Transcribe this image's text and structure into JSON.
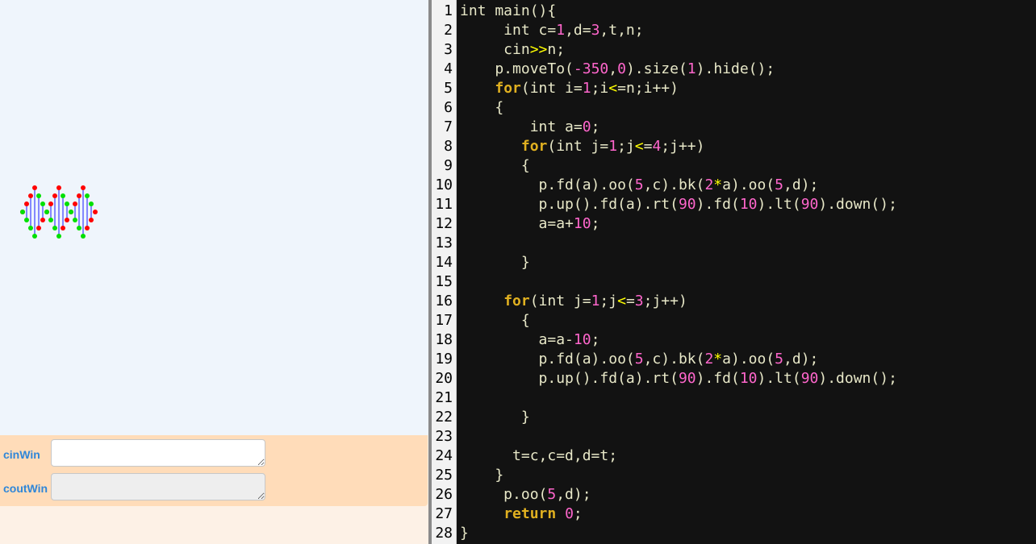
{
  "canvas": {
    "drawing": "dna-helix",
    "colors": {
      "strand_a": "#ff0000",
      "strand_b": "#00e000",
      "rung": "#1a1aff"
    }
  },
  "io": {
    "cin_label": "cinWin",
    "cout_label": "coutWin",
    "cin_value": "",
    "cout_value": ""
  },
  "editor": {
    "theme": {
      "background": "#121212",
      "keyword": "#e0b020",
      "number": "#ff66cc",
      "operator": "#ffff00",
      "text": "#e8e8c8",
      "gutter_bg": "#f2f2f2"
    },
    "lines": [
      {
        "n": "1",
        "segs": [
          {
            "t": "int main(){",
            "c": "text"
          }
        ]
      },
      {
        "n": "2",
        "segs": [
          {
            "t": "     int c=",
            "c": "text"
          },
          {
            "t": "1",
            "c": "number"
          },
          {
            "t": ",d=",
            "c": "text"
          },
          {
            "t": "3",
            "c": "number"
          },
          {
            "t": ",t,n;",
            "c": "text"
          }
        ]
      },
      {
        "n": "3",
        "segs": [
          {
            "t": "     cin",
            "c": "text"
          },
          {
            "t": ">>",
            "c": "operator"
          },
          {
            "t": "n;",
            "c": "text"
          }
        ]
      },
      {
        "n": "4",
        "segs": [
          {
            "t": "    p.moveTo(",
            "c": "text"
          },
          {
            "t": "-350",
            "c": "number"
          },
          {
            "t": ",",
            "c": "text"
          },
          {
            "t": "0",
            "c": "number"
          },
          {
            "t": ").size(",
            "c": "text"
          },
          {
            "t": "1",
            "c": "number"
          },
          {
            "t": ").hide();",
            "c": "text"
          }
        ]
      },
      {
        "n": "5",
        "segs": [
          {
            "t": "    ",
            "c": "text"
          },
          {
            "t": "for",
            "c": "keyword"
          },
          {
            "t": "(int i=",
            "c": "text"
          },
          {
            "t": "1",
            "c": "number"
          },
          {
            "t": ";i",
            "c": "text"
          },
          {
            "t": "<",
            "c": "operator"
          },
          {
            "t": "=n;i++)",
            "c": "text"
          }
        ]
      },
      {
        "n": "6",
        "segs": [
          {
            "t": "    {",
            "c": "text"
          }
        ]
      },
      {
        "n": "7",
        "segs": [
          {
            "t": "        int a=",
            "c": "text"
          },
          {
            "t": "0",
            "c": "number"
          },
          {
            "t": ";",
            "c": "text"
          }
        ]
      },
      {
        "n": "8",
        "segs": [
          {
            "t": "       ",
            "c": "text"
          },
          {
            "t": "for",
            "c": "keyword"
          },
          {
            "t": "(int j=",
            "c": "text"
          },
          {
            "t": "1",
            "c": "number"
          },
          {
            "t": ";j",
            "c": "text"
          },
          {
            "t": "<",
            "c": "operator"
          },
          {
            "t": "=",
            "c": "text"
          },
          {
            "t": "4",
            "c": "number"
          },
          {
            "t": ";j++)",
            "c": "text"
          }
        ]
      },
      {
        "n": "9",
        "segs": [
          {
            "t": "       {",
            "c": "text"
          }
        ]
      },
      {
        "n": "10",
        "segs": [
          {
            "t": "         p.fd(a).oo(",
            "c": "text"
          },
          {
            "t": "5",
            "c": "number"
          },
          {
            "t": ",c).bk(",
            "c": "text"
          },
          {
            "t": "2",
            "c": "number"
          },
          {
            "t": "*",
            "c": "operator"
          },
          {
            "t": "a).oo(",
            "c": "text"
          },
          {
            "t": "5",
            "c": "number"
          },
          {
            "t": ",d);",
            "c": "text"
          }
        ]
      },
      {
        "n": "11",
        "segs": [
          {
            "t": "         p.up().fd(a).rt(",
            "c": "text"
          },
          {
            "t": "90",
            "c": "number"
          },
          {
            "t": ").fd(",
            "c": "text"
          },
          {
            "t": "10",
            "c": "number"
          },
          {
            "t": ").lt(",
            "c": "text"
          },
          {
            "t": "90",
            "c": "number"
          },
          {
            "t": ").down();",
            "c": "text"
          }
        ]
      },
      {
        "n": "12",
        "segs": [
          {
            "t": "         a=a+",
            "c": "text"
          },
          {
            "t": "10",
            "c": "number"
          },
          {
            "t": ";",
            "c": "text"
          }
        ]
      },
      {
        "n": "13",
        "segs": [
          {
            "t": "",
            "c": "text"
          }
        ]
      },
      {
        "n": "14",
        "segs": [
          {
            "t": "       }",
            "c": "text"
          }
        ]
      },
      {
        "n": "15",
        "segs": [
          {
            "t": "",
            "c": "text"
          }
        ]
      },
      {
        "n": "16",
        "segs": [
          {
            "t": "     ",
            "c": "text"
          },
          {
            "t": "for",
            "c": "keyword"
          },
          {
            "t": "(int j=",
            "c": "text"
          },
          {
            "t": "1",
            "c": "number"
          },
          {
            "t": ";j",
            "c": "text"
          },
          {
            "t": "<",
            "c": "operator"
          },
          {
            "t": "=",
            "c": "text"
          },
          {
            "t": "3",
            "c": "number"
          },
          {
            "t": ";j++)",
            "c": "text"
          }
        ]
      },
      {
        "n": "17",
        "segs": [
          {
            "t": "       {",
            "c": "text"
          }
        ]
      },
      {
        "n": "18",
        "segs": [
          {
            "t": "         a=a-",
            "c": "text"
          },
          {
            "t": "10",
            "c": "number"
          },
          {
            "t": ";",
            "c": "text"
          }
        ]
      },
      {
        "n": "19",
        "segs": [
          {
            "t": "         p.fd(a).oo(",
            "c": "text"
          },
          {
            "t": "5",
            "c": "number"
          },
          {
            "t": ",c).bk(",
            "c": "text"
          },
          {
            "t": "2",
            "c": "number"
          },
          {
            "t": "*",
            "c": "operator"
          },
          {
            "t": "a).oo(",
            "c": "text"
          },
          {
            "t": "5",
            "c": "number"
          },
          {
            "t": ",d);",
            "c": "text"
          }
        ]
      },
      {
        "n": "20",
        "segs": [
          {
            "t": "         p.up().fd(a).rt(",
            "c": "text"
          },
          {
            "t": "90",
            "c": "number"
          },
          {
            "t": ").fd(",
            "c": "text"
          },
          {
            "t": "10",
            "c": "number"
          },
          {
            "t": ").lt(",
            "c": "text"
          },
          {
            "t": "90",
            "c": "number"
          },
          {
            "t": ").down();",
            "c": "text"
          }
        ]
      },
      {
        "n": "21",
        "segs": [
          {
            "t": "",
            "c": "text"
          }
        ]
      },
      {
        "n": "22",
        "segs": [
          {
            "t": "       }",
            "c": "text"
          }
        ]
      },
      {
        "n": "23",
        "segs": [
          {
            "t": "",
            "c": "text"
          }
        ]
      },
      {
        "n": "24",
        "segs": [
          {
            "t": "      t=c,c=d,d=t;",
            "c": "text"
          }
        ]
      },
      {
        "n": "25",
        "segs": [
          {
            "t": "    }",
            "c": "text"
          }
        ]
      },
      {
        "n": "26",
        "segs": [
          {
            "t": "     p.oo(",
            "c": "text"
          },
          {
            "t": "5",
            "c": "number"
          },
          {
            "t": ",d);",
            "c": "text"
          }
        ]
      },
      {
        "n": "27",
        "segs": [
          {
            "t": "     ",
            "c": "text"
          },
          {
            "t": "return",
            "c": "keyword"
          },
          {
            "t": " ",
            "c": "text"
          },
          {
            "t": "0",
            "c": "number"
          },
          {
            "t": ";",
            "c": "text"
          }
        ]
      },
      {
        "n": "28",
        "segs": [
          {
            "t": "}",
            "c": "text"
          }
        ]
      }
    ]
  }
}
